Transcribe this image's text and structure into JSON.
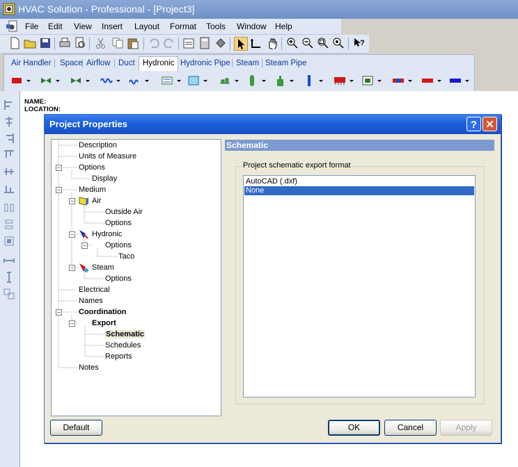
{
  "app": {
    "title": "HVAC Solution - Professional - [Project3]"
  },
  "menu": [
    "File",
    "Edit",
    "View",
    "Insert",
    "Layout",
    "Format",
    "Tools",
    "Window",
    "Help"
  ],
  "tabs": [
    "Air Handler",
    "Space",
    "Airflow",
    "Duct",
    "Hydronic",
    "Hydronic Pipe",
    "Steam",
    "Steam Pipe"
  ],
  "active_tab": "Hydronic",
  "drawing": {
    "name_label": "NAME:",
    "location_label": "LOCATION:"
  },
  "dialog": {
    "title": "Project Properties",
    "help_glyph": "?",
    "close_glyph": "✕",
    "section_title": "Schematic",
    "group_label": "Project schematic export format",
    "formats": [
      "AutoCAD (.dxf)",
      "None"
    ],
    "selected_format": "None",
    "buttons": {
      "default": "Default",
      "ok": "OK",
      "cancel": "Cancel",
      "apply": "Apply"
    },
    "tree": [
      {
        "label": "Description"
      },
      {
        "label": "Units of Measure"
      },
      {
        "label": "Options"
      },
      {
        "label": "Display"
      },
      {
        "label": "Medium"
      },
      {
        "label": "Air"
      },
      {
        "label": "Outside Air"
      },
      {
        "label": "Options"
      },
      {
        "label": "Hydronic"
      },
      {
        "label": "Options"
      },
      {
        "label": "Taco"
      },
      {
        "label": "Steam"
      },
      {
        "label": "Options"
      },
      {
        "label": "Electrical"
      },
      {
        "label": "Names"
      },
      {
        "label": "Coordination"
      },
      {
        "label": "Export"
      },
      {
        "label": "Schematic"
      },
      {
        "label": "Schedules"
      },
      {
        "label": "Reports"
      },
      {
        "label": "Notes"
      }
    ]
  },
  "colors": {
    "dialog_title": "#1e5fd8",
    "selection": "#316ac5",
    "section_header": "#7b9ad0"
  }
}
